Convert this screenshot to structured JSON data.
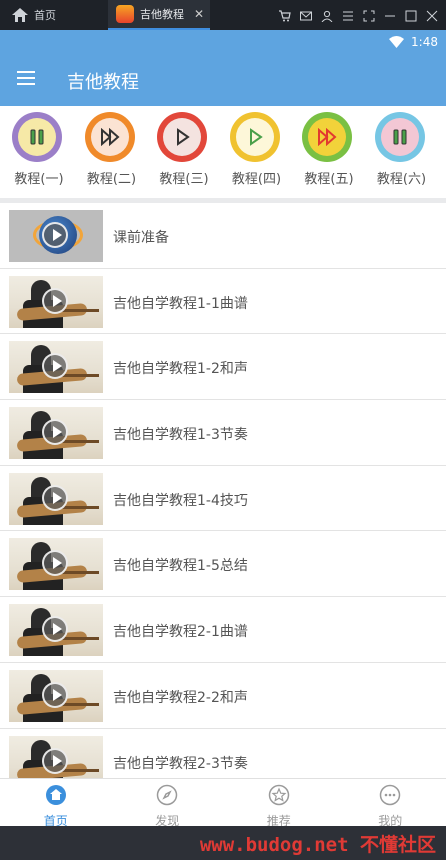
{
  "emulator": {
    "home_label": "首页",
    "tab_label": "吉他教程",
    "tab_close": "✕"
  },
  "status": {
    "time": "1:48"
  },
  "app": {
    "title": "吉他教程"
  },
  "tutorials": [
    {
      "label": "教程(一)",
      "ring": "#9b7fc8",
      "fill": "#f6e9a7",
      "glyph": "pause",
      "glyph_color": "#4aa04a"
    },
    {
      "label": "教程(二)",
      "ring": "#f08a2a",
      "fill": "#fbe3d3",
      "glyph": "fast-forward",
      "glyph_color": "#333"
    },
    {
      "label": "教程(三)",
      "ring": "#e2473a",
      "fill": "#f4e3e0",
      "glyph": "play",
      "glyph_color": "#333"
    },
    {
      "label": "教程(四)",
      "ring": "#f0c230",
      "fill": "#fdf7d9",
      "glyph": "play",
      "glyph_color": "#4aa04a"
    },
    {
      "label": "教程(五)",
      "ring": "#7ac043",
      "fill": "#f2d23a",
      "glyph": "fast-forward",
      "glyph_color": "#e23a2f"
    },
    {
      "label": "教程(六)",
      "ring": "#76c6e4",
      "fill": "#f3c7d4",
      "glyph": "pause",
      "glyph_color": "#4aa04a"
    }
  ],
  "lessons": [
    {
      "title": "课前准备",
      "thumb": "intro"
    },
    {
      "title": "吉他自学教程1-1曲谱",
      "thumb": "guitar"
    },
    {
      "title": "吉他自学教程1-2和声",
      "thumb": "guitar"
    },
    {
      "title": "吉他自学教程1-3节奏",
      "thumb": "guitar"
    },
    {
      "title": "吉他自学教程1-4技巧",
      "thumb": "guitar"
    },
    {
      "title": "吉他自学教程1-5总结",
      "thumb": "guitar"
    },
    {
      "title": "吉他自学教程2-1曲谱",
      "thumb": "guitar"
    },
    {
      "title": "吉他自学教程2-2和声",
      "thumb": "guitar"
    },
    {
      "title": "吉他自学教程2-3节奏",
      "thumb": "guitar"
    }
  ],
  "bottom_nav": [
    {
      "label": "首页",
      "icon": "home-icon",
      "active": true
    },
    {
      "label": "发现",
      "icon": "compass-icon",
      "active": false
    },
    {
      "label": "推荐",
      "icon": "star-icon",
      "active": false
    },
    {
      "label": "我的",
      "icon": "more-icon",
      "active": false
    }
  ],
  "watermark": "www.budog.net 不懂社区",
  "colors": {
    "accent": "#5ea4e0",
    "nav_active": "#3b8fdc",
    "watermark": "#e03a35"
  }
}
